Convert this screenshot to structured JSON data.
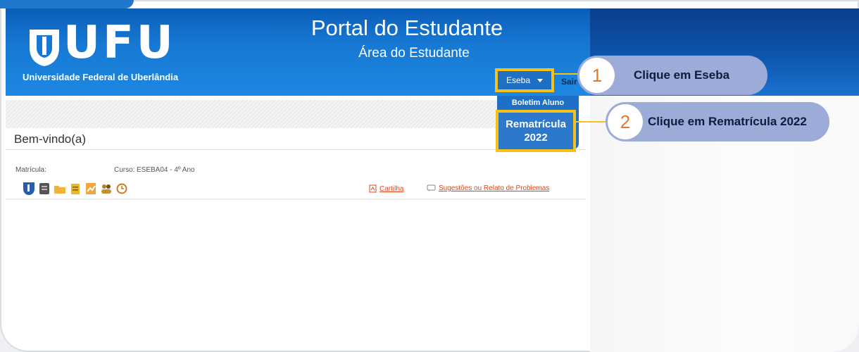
{
  "header": {
    "logo_text": "UFU",
    "university": "Universidade Federal de Uberlândia",
    "portal_title": "Portal do Estudante",
    "portal_subtitle": "Área do Estudante"
  },
  "nav": {
    "eseba_label": "Eseba",
    "sair_label": "Sair"
  },
  "dropdown": {
    "items": [
      "Boletim Aluno",
      "Rematrícula",
      "2022"
    ]
  },
  "content": {
    "welcome": "Bem-vindo(a)",
    "matricula_label": "Matrícula:",
    "curso_label": "Curso:",
    "curso_value": "ESEBA04 - 4º Ano",
    "cartilha_link": "Cartilha",
    "sugestoes_link": "Sugestões ou Relato de Problemas"
  },
  "callouts": [
    {
      "number": "1",
      "text": "Clique em Eseba"
    },
    {
      "number": "2",
      "text": "Clique em Rematrícula 2022"
    }
  ],
  "colors": {
    "highlight": "#f6c21a",
    "callout_bg": "#9dabd9",
    "link": "#e0441b",
    "header_blue": "#1678d2"
  }
}
